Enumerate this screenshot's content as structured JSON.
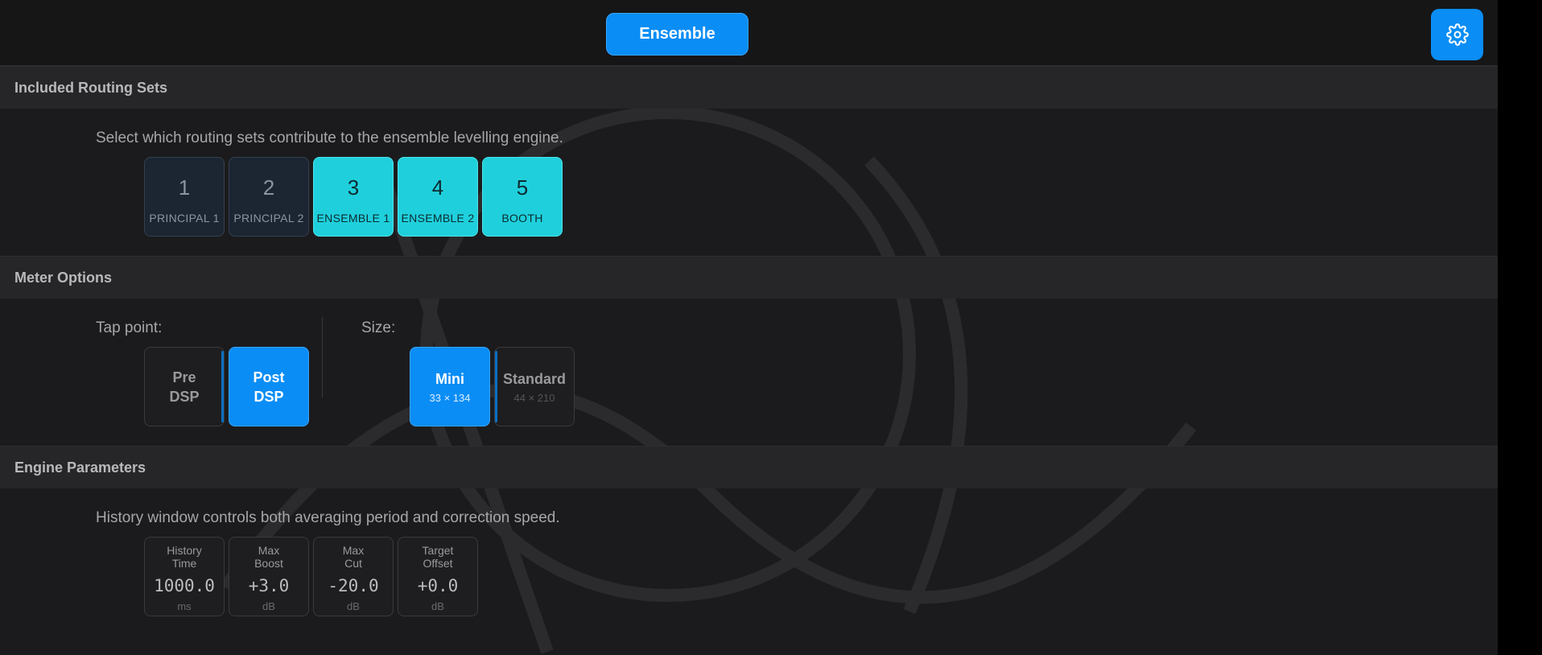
{
  "topbar": {
    "mode_button": "Ensemble",
    "settings_icon": "gear-icon"
  },
  "routing_sets": {
    "header": "Included Routing Sets",
    "description": "Select which routing sets contribute to the ensemble levelling engine.",
    "items": [
      {
        "number": "1",
        "label": "PRINCIPAL 1",
        "selected": false
      },
      {
        "number": "2",
        "label": "PRINCIPAL 2",
        "selected": false
      },
      {
        "number": "3",
        "label": "ENSEMBLE 1",
        "selected": true
      },
      {
        "number": "4",
        "label": "ENSEMBLE 2",
        "selected": true
      },
      {
        "number": "5",
        "label": "BOOTH",
        "selected": true
      }
    ]
  },
  "meter_options": {
    "header": "Meter Options",
    "tap_point_label": "Tap point:",
    "tap_pre": {
      "line1": "Pre",
      "line2": "DSP",
      "selected": false
    },
    "tap_post": {
      "line1": "Post",
      "line2": "DSP",
      "selected": true
    },
    "size_label": "Size:",
    "size_mini": {
      "label": "Mini",
      "dims": "33 × 134",
      "selected": true
    },
    "size_standard": {
      "label": "Standard",
      "dims": "44 × 210",
      "selected": false
    }
  },
  "engine": {
    "header": "Engine Parameters",
    "description": "History window controls both averaging period and correction speed.",
    "params": [
      {
        "title": "History\nTime",
        "value": "1000.0",
        "unit": "ms"
      },
      {
        "title": "Max\nBoost",
        "value": "+3.0",
        "unit": "dB"
      },
      {
        "title": "Max\nCut",
        "value": "-20.0",
        "unit": "dB"
      },
      {
        "title": "Target\nOffset",
        "value": "+0.0",
        "unit": "dB"
      }
    ]
  },
  "colors": {
    "accent_blue": "#0a8df5",
    "accent_cyan": "#1fd0dc",
    "panel": "#1b1b1d",
    "header": "#262628"
  }
}
